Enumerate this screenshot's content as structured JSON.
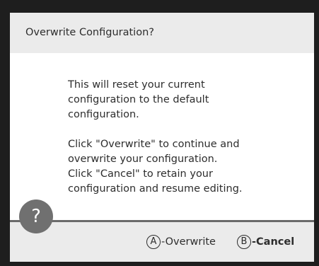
{
  "dialog": {
    "title": "Overwrite Configuration?",
    "paragraph_1": "This will reset your current\nconfiguration to the default\nconfiguration.",
    "paragraph_2": "Click \"Overwrite\" to continue and\noverwrite your configuration.\nClick \"Cancel\" to retain your\nconfiguration and resume editing."
  },
  "help_button": {
    "symbol": "?"
  },
  "footer": {
    "overwrite": {
      "glyph": "A",
      "label": "-Overwrite"
    },
    "cancel": {
      "glyph": "B",
      "label": "-Cancel"
    }
  },
  "colors": {
    "backdrop": "#1e1e1e",
    "header_footer": "#ebebeb",
    "body": "#ffffff",
    "divider": "#6b6b6b",
    "help_button": "#707070",
    "text": "#2d2d2d"
  },
  "icons": {
    "help": "question-mark-icon",
    "confirm": "a-button-glyph-icon",
    "cancel": "b-button-glyph-icon"
  }
}
